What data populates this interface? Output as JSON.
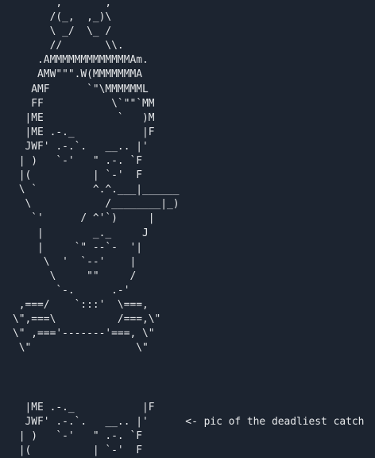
{
  "ascii_art": {
    "main": "       ,       ,\n      /(_,  ,_)\\\n      \\ _/  \\_ /\n      //       \\\\.\n    .AMMMMMMMMMMMMMAm.\n    AMW\"\"\".W(MMMMMMMA\n   AMF      `\"\\MMMMMML\n   FF           \\`\"\"`MM\n  |ME            `   )M\n  |ME .-._           |F\n  JWF' .-.`.   __.. |'\n | )   `-'   \" .-. `F\n |(          | `-'  F\n \\ `         ^.^.___|______\n  \\            /________|_)\n   `'      / ^'`)     |\n    |        _._     J\n    |     `\" --`-  '|\n     \\  '  `--'    |\n      \\     \"\"     /\n       `-.      .-'\n ,===/    `:::'  \\===,\n\\\",===\\          /===,\\\"\n\\\" ,==='-------'===, \\\"\n \\\"                 \\\"",
    "repeat": "  |ME .-._           |F\n  JWF' .-.`.   __.. |'      <- pic of the deadliest catch\n | )   `-'   \" .-. `F\n |(          | `-'  F"
  }
}
